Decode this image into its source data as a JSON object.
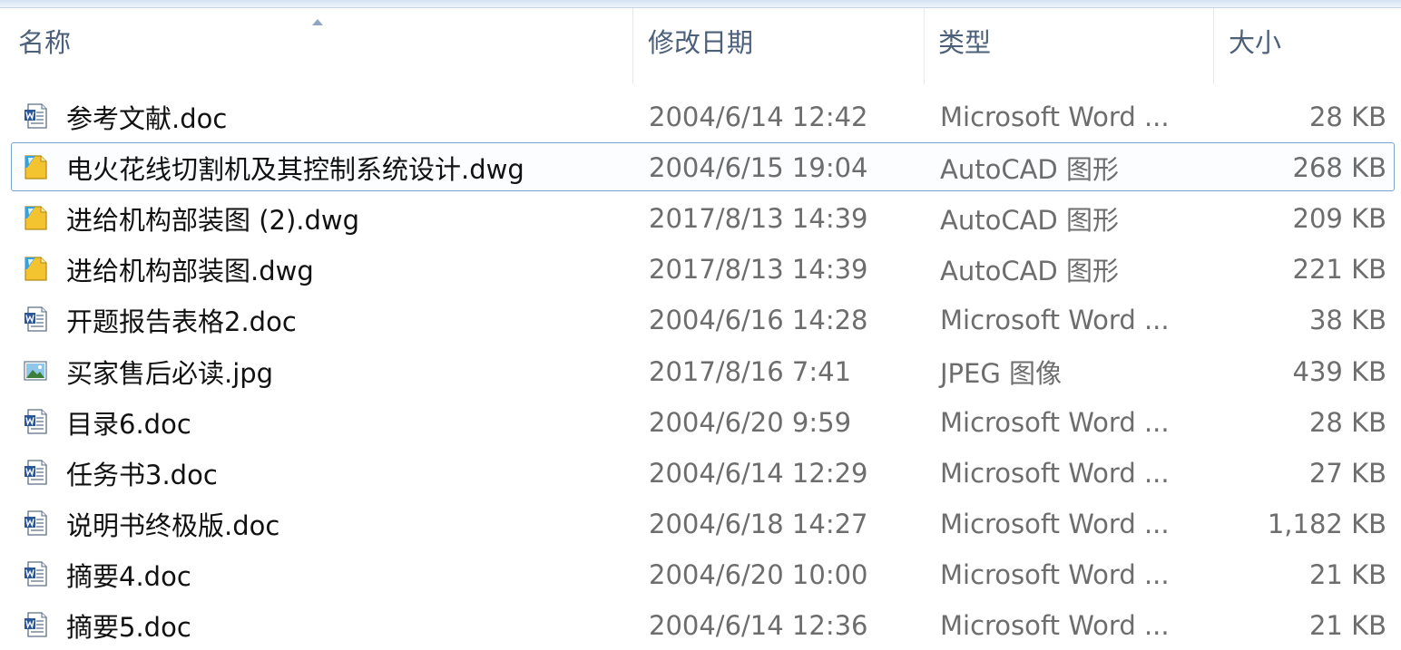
{
  "columns": {
    "name": "名称",
    "date": "修改日期",
    "type": "类型",
    "size": "大小"
  },
  "files": [
    {
      "name": "参考文献.doc",
      "date": "2004/6/14 12:42",
      "type": "Microsoft Word ...",
      "size": "28 KB",
      "icon": "word-doc-icon"
    },
    {
      "name": "电火花线切割机及其控制系统设计.dwg",
      "date": "2004/6/15 19:04",
      "type": "AutoCAD 图形",
      "size": "268 KB",
      "icon": "autocad-dwg-icon",
      "selected": true
    },
    {
      "name": "进给机构部装图 (2).dwg",
      "date": "2017/8/13 14:39",
      "type": "AutoCAD 图形",
      "size": "209 KB",
      "icon": "autocad-dwg-icon"
    },
    {
      "name": "进给机构部装图.dwg",
      "date": "2017/8/13 14:39",
      "type": "AutoCAD 图形",
      "size": "221 KB",
      "icon": "autocad-dwg-icon"
    },
    {
      "name": "开题报告表格2.doc",
      "date": "2004/6/16 14:28",
      "type": "Microsoft Word ...",
      "size": "38 KB",
      "icon": "word-doc-icon"
    },
    {
      "name": "买家售后必读.jpg",
      "date": "2017/8/16 7:41",
      "type": "JPEG 图像",
      "size": "439 KB",
      "icon": "jpeg-image-icon"
    },
    {
      "name": "目录6.doc",
      "date": "2004/6/20 9:59",
      "type": "Microsoft Word ...",
      "size": "28 KB",
      "icon": "word-doc-icon"
    },
    {
      "name": "任务书3.doc",
      "date": "2004/6/14 12:29",
      "type": "Microsoft Word ...",
      "size": "27 KB",
      "icon": "word-doc-icon"
    },
    {
      "name": "说明书终极版.doc",
      "date": "2004/6/18 14:27",
      "type": "Microsoft Word ...",
      "size": "1,182 KB",
      "icon": "word-doc-icon"
    },
    {
      "name": "摘要4.doc",
      "date": "2004/6/20 10:00",
      "type": "Microsoft Word ...",
      "size": "21 KB",
      "icon": "word-doc-icon"
    },
    {
      "name": "摘要5.doc",
      "date": "2004/6/14 12:36",
      "type": "Microsoft Word ...",
      "size": "21 KB",
      "icon": "word-doc-icon"
    }
  ]
}
